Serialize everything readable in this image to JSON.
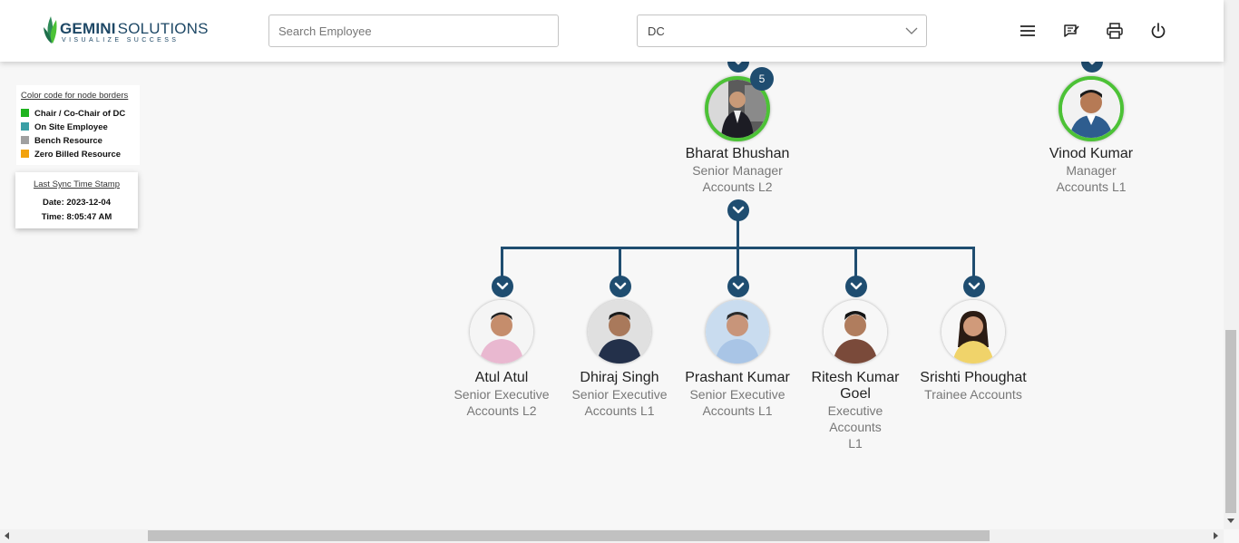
{
  "header": {
    "logo_word_bold": "GEMINI",
    "logo_word_light": "SOLUTIONS",
    "logo_tagline": "VISUALIZE SUCCESS",
    "search_placeholder": "Search Employee",
    "dc_select_value": "DC",
    "icons": [
      "menu-icon",
      "feedback-icon",
      "print-icon",
      "power-icon"
    ]
  },
  "legend": {
    "title": "Color code for node borders",
    "items": [
      {
        "label": "Chair / Co-Chair of DC",
        "color": "#1fb31f"
      },
      {
        "label": "On Site Employee",
        "color": "#3a9fa5"
      },
      {
        "label": "Bench Resource",
        "color": "#a0a0a0"
      },
      {
        "label": "Zero Billed Resource",
        "color": "#f2a20c"
      }
    ]
  },
  "sync": {
    "title": "Last Sync Time Stamp",
    "date": "Date: 2023-12-04",
    "time": "Time: 8:05:47 AM"
  },
  "colors": {
    "primary": "#1f4d70",
    "chair_border": "#4cc236"
  },
  "managers": [
    {
      "name": "Bharat Bhushan",
      "role": "Senior Manager Accounts L2",
      "reports_count": "5"
    },
    {
      "name": "Vinod Kumar",
      "role": "Manager Accounts L1"
    }
  ],
  "reports": [
    {
      "name": "Atul Atul",
      "role": "Senior Executive Accounts L2"
    },
    {
      "name": "Dhiraj Singh",
      "role": "Senior Executive Accounts L1"
    },
    {
      "name": "Prashant Kumar",
      "role": "Senior Executive Accounts L1"
    },
    {
      "name": "Ritesh Kumar Goel",
      "role": "Executive Accounts L1"
    },
    {
      "name": "Srishti Phoughat",
      "role": "Trainee Accounts"
    }
  ]
}
